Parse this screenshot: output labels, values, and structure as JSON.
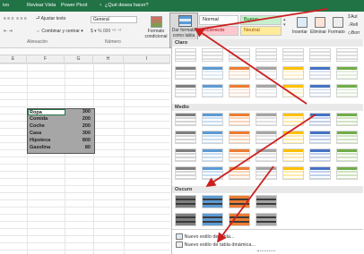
{
  "tabs": {
    "file": "Archivo",
    "items": [
      "ivo",
      "Inicio",
      "Insertar",
      "Diseño",
      "Revisar",
      "Vista",
      "Power Pivot"
    ],
    "tell_me": "¿Qué desea hacer?"
  },
  "ribbon": {
    "wrap_text": "Ajustar texto",
    "merge_center": "Combinar y centrar",
    "number_format": "General",
    "alignment_group": "Alineación",
    "number_group": "Número",
    "conditional_format": "Formato condicional",
    "format_as_table": "Dar formato como tabla",
    "style_normal": "Normal",
    "style_good": "Bueno",
    "style_incorrect": "Incorrecto",
    "style_neutral": "Neutral",
    "insert": "Insertar",
    "delete": "Eliminar",
    "format": "Formato",
    "autosum_fragment": "Aut",
    "fill_fragment": "Rell",
    "clear_fragment": "Borr"
  },
  "columns": [
    "E",
    "F",
    "G",
    "H",
    "I"
  ],
  "table": [
    {
      "item": "Ropa",
      "value": "300"
    },
    {
      "item": "Comida",
      "value": "200"
    },
    {
      "item": "Coche",
      "value": "200"
    },
    {
      "item": "Casa",
      "value": "300"
    },
    {
      "item": "Hipoteca",
      "value": "800"
    },
    {
      "item": "Gasolina",
      "value": "80"
    }
  ],
  "gallery": {
    "light_section": "Claro",
    "medium_section": "Medio",
    "dark_section": "Oscuro",
    "new_table_style": "Nuevo estilo de tabla...",
    "new_pivot_style": "Nuevo estilo de tabla dinámica..."
  },
  "colors": {
    "accent_tabs": "#217346",
    "good_bg": "#c6efce",
    "good_fg": "#006100",
    "bad_bg": "#ffc7ce",
    "bad_fg": "#9c0006",
    "neutral_bg": "#ffeb9c",
    "neutral_fg": "#9c5700",
    "arrow": "#cc1f1f",
    "swatches": [
      "#7f7f7f",
      "#5b9bd5",
      "#ed7d31",
      "#a5a5a5",
      "#ffc000",
      "#4472c4",
      "#70ad47"
    ]
  }
}
